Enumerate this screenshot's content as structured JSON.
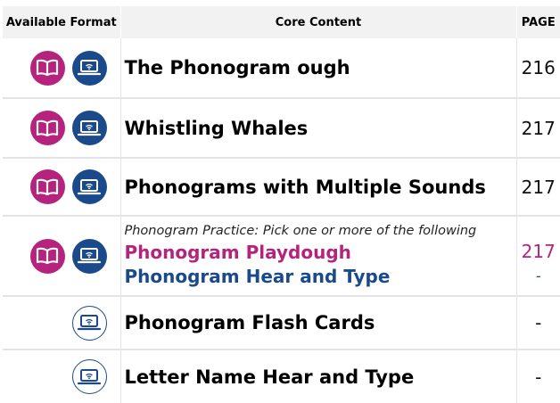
{
  "headers": {
    "formats": "Available Format",
    "content": "Core Content",
    "page": "PAGE"
  },
  "rows": [
    {
      "title": "The Phonogram ough",
      "page": "216",
      "formats": [
        "book-icon",
        "laptop-icon"
      ]
    },
    {
      "title": "Whistling Whales",
      "page": "217",
      "formats": [
        "book-icon",
        "laptop-icon"
      ]
    },
    {
      "title": "Phonograms with Multiple Sounds",
      "page": "217",
      "formats": [
        "book-icon",
        "laptop-icon"
      ]
    },
    {
      "instruction": "Phonogram Practice: Pick one or more of the following",
      "options": [
        {
          "label": "Phonogram Playdough",
          "page": "217"
        },
        {
          "label": "Phonogram Hear and Type",
          "page": "-"
        }
      ],
      "formats": [
        "book-icon",
        "laptop-icon"
      ]
    },
    {
      "title": "Phonogram Flash Cards",
      "page": "-",
      "formats": [
        "laptop-outline-icon"
      ]
    },
    {
      "title": "Letter Name Hear and Type",
      "page": "-",
      "formats": [
        "laptop-outline-icon"
      ]
    }
  ],
  "colors": {
    "book": "#b5237d",
    "laptop": "#1b4a8c",
    "header_bg": "#f2f2f2",
    "rule": "#e4e4e4"
  }
}
